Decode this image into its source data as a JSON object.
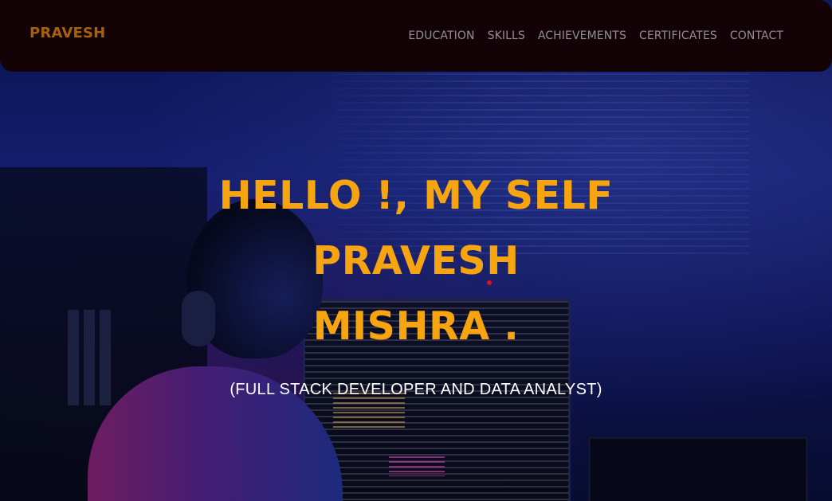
{
  "navbar": {
    "brand": "PRAVESH",
    "links": [
      "EDUCATION",
      "SKILLS",
      "ACHIEVEMENTS",
      "CERTIFICATES",
      "CONTACT"
    ]
  },
  "hero": {
    "line1": "HELLO !, MY SELF",
    "line2": "PRAVESH",
    "line3": "MISHRA .",
    "subtitle": "(FULL STACK DEVELOPER AND DATA ANALYST)"
  },
  "colors": {
    "accent": "#f6a40f",
    "brand": "#a5610c",
    "navbar_bg": "#140306",
    "nav_text": "#8f8f95"
  },
  "icons": {
    "cursor_dot": "red-dot-icon"
  }
}
